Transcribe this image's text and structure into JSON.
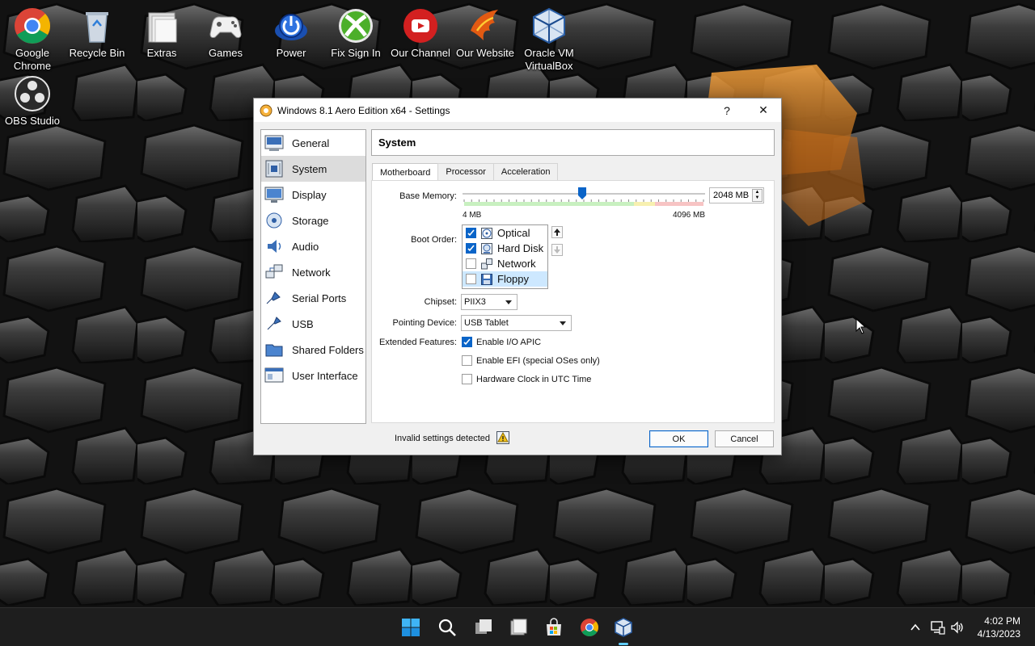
{
  "desktop": {
    "icons": [
      {
        "label": "Google Chrome"
      },
      {
        "label": "Recycle Bin"
      },
      {
        "label": "Extras"
      },
      {
        "label": "Games"
      },
      {
        "label": "Power"
      },
      {
        "label": "Fix Sign In"
      },
      {
        "label": "Our Channel"
      },
      {
        "label": "Our Website"
      },
      {
        "label": "Oracle VM VirtualBox"
      },
      {
        "label": "OBS Studio"
      }
    ]
  },
  "dialog": {
    "title": "Windows 8.1 Aero Edition x64 - Settings",
    "help_label": "?",
    "close_label": "✕",
    "sidebar": [
      {
        "label": "General",
        "icon": "general-icon",
        "active": false
      },
      {
        "label": "System",
        "icon": "system-icon",
        "active": true
      },
      {
        "label": "Display",
        "icon": "display-icon",
        "active": false
      },
      {
        "label": "Storage",
        "icon": "storage-icon",
        "active": false
      },
      {
        "label": "Audio",
        "icon": "audio-icon",
        "active": false
      },
      {
        "label": "Network",
        "icon": "network-icon",
        "active": false
      },
      {
        "label": "Serial Ports",
        "icon": "serial-ports-icon",
        "active": false
      },
      {
        "label": "USB",
        "icon": "usb-icon",
        "active": false
      },
      {
        "label": "Shared Folders",
        "icon": "shared-folders-icon",
        "active": false
      },
      {
        "label": "User Interface",
        "icon": "user-interface-icon",
        "active": false
      }
    ],
    "page_title": "System",
    "tabs": [
      {
        "label": "Motherboard",
        "active": true
      },
      {
        "label": "Processor",
        "active": false
      },
      {
        "label": "Acceleration",
        "active": false
      }
    ],
    "motherboard": {
      "base_memory_label": "Base Memory:",
      "base_memory_value": "2048 MB",
      "memory_min_label": "4 MB",
      "memory_max_label": "4096 MB",
      "memory_fraction": 0.5,
      "boot_order_label": "Boot Order:",
      "boot_items": [
        {
          "label": "Optical",
          "checked": true,
          "icon": "optical-disc-icon"
        },
        {
          "label": "Hard Disk",
          "checked": true,
          "icon": "hard-disk-icon"
        },
        {
          "label": "Network",
          "checked": false,
          "icon": "network-icon"
        },
        {
          "label": "Floppy",
          "checked": false,
          "icon": "floppy-icon",
          "selected": true
        }
      ],
      "chipset_label": "Chipset:",
      "chipset_value": "PIIX3",
      "pointing_label": "Pointing Device:",
      "pointing_value": "USB Tablet",
      "extended_label": "Extended Features:",
      "features": [
        {
          "label": "Enable I/O APIC",
          "checked": true
        },
        {
          "label": "Enable EFI (special OSes only)",
          "checked": false
        },
        {
          "label": "Hardware Clock in UTC Time",
          "checked": false
        }
      ]
    },
    "status_text": "Invalid settings detected",
    "ok_label": "OK",
    "cancel_label": "Cancel"
  },
  "taskbar": {
    "time": "4:02 PM",
    "date": "4/13/2023",
    "accent": "#60cdff"
  }
}
